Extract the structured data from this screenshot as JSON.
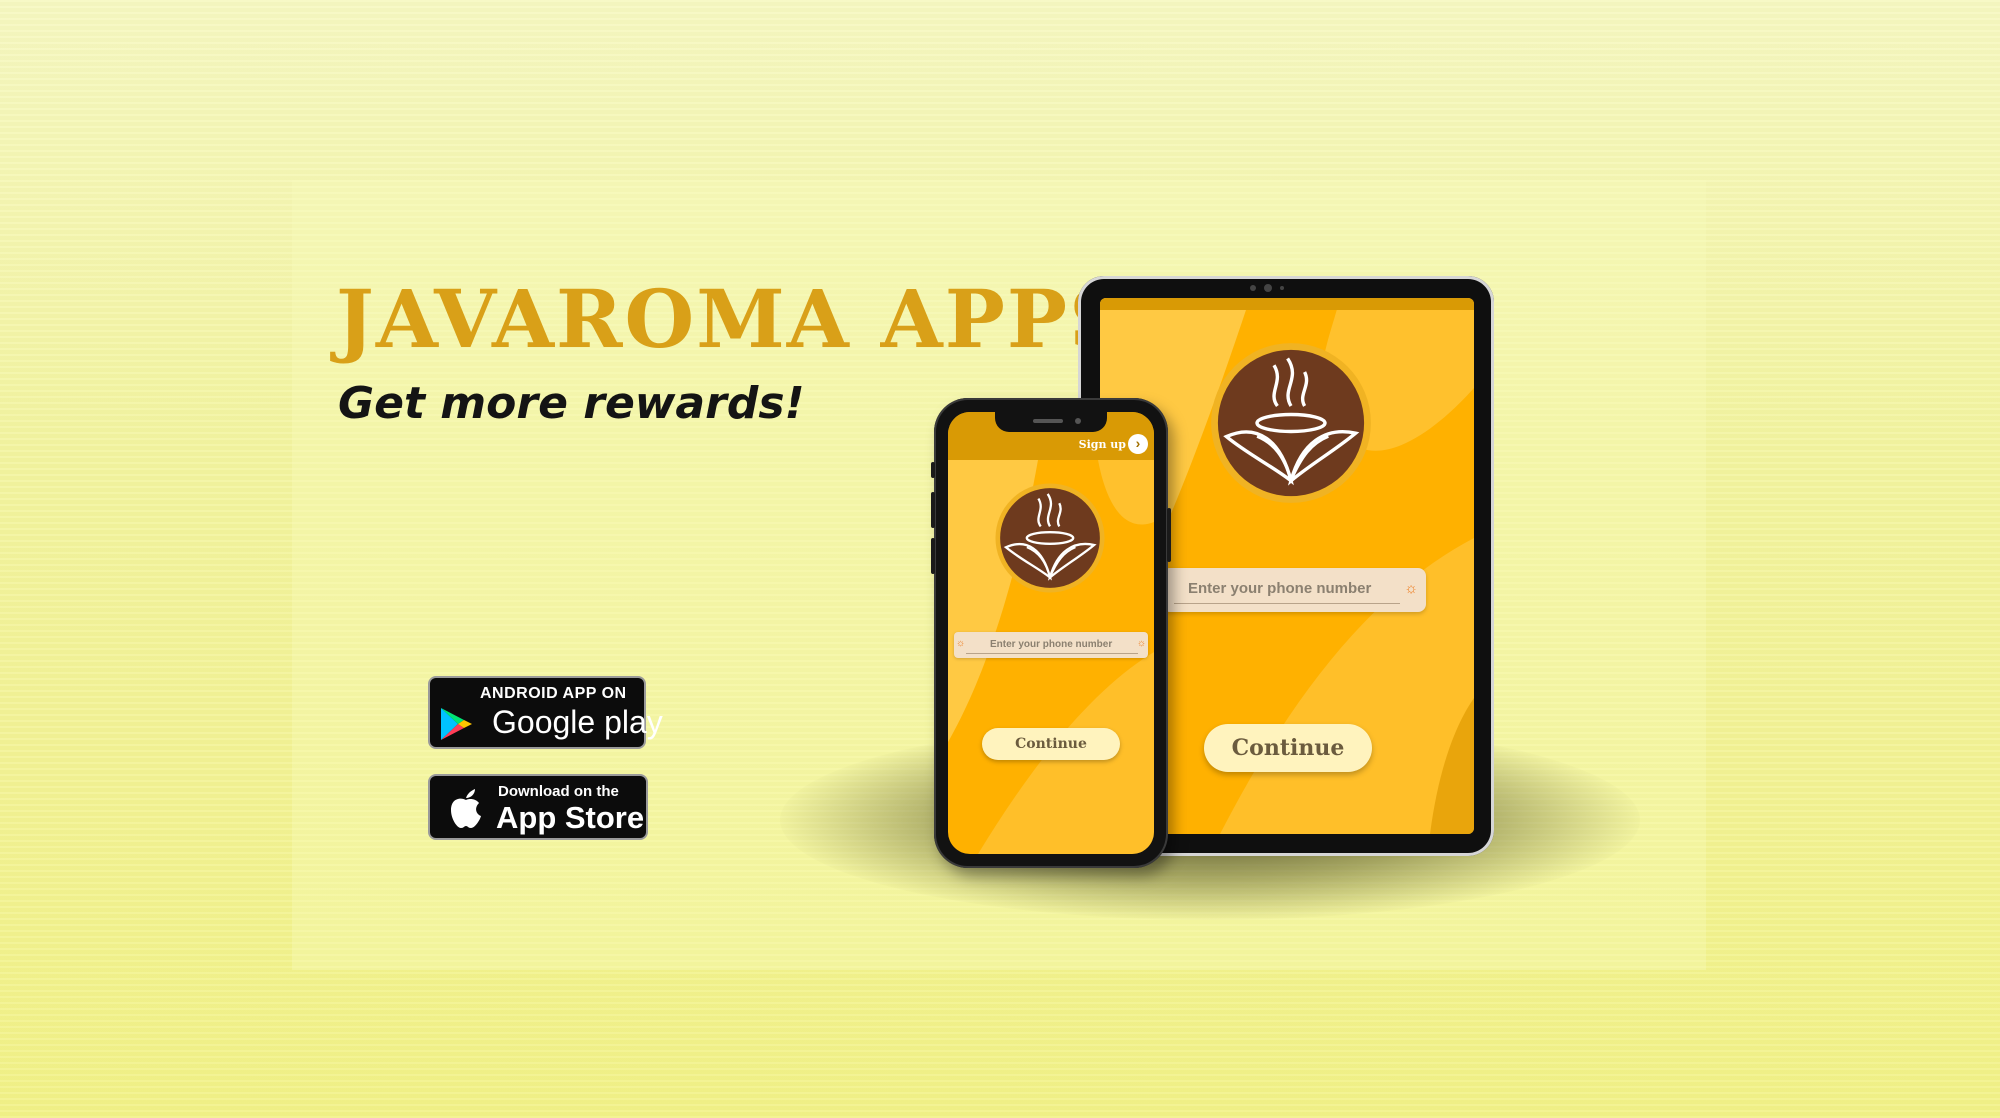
{
  "hero": {
    "title": "JAVAROMA APPS",
    "subtitle": "Get more rewards!"
  },
  "badges": {
    "google_play": {
      "small": "ANDROID APP ON",
      "big": "Google play"
    },
    "app_store": {
      "small": "Download on the",
      "big": "App Store"
    }
  },
  "phone": {
    "signup_label": "Sign up",
    "signup_arrow": "›",
    "phone_placeholder": "Enter your phone number",
    "continue_label": "Continue"
  },
  "tablet": {
    "phone_placeholder": "Enter your phone number",
    "continue_label": "Continue"
  },
  "colors": {
    "title": "#d9a018",
    "screen": "#ffb100",
    "header": "#d99a05",
    "logo_brown": "#6e3a1e",
    "button": "#fff3be"
  },
  "icons": {
    "input_icon": "☼"
  }
}
